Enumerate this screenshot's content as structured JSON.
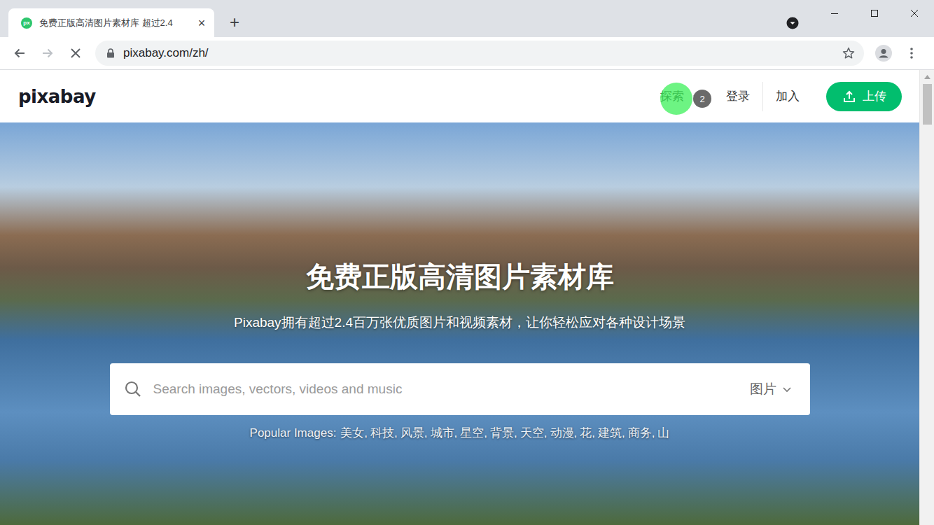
{
  "tabs": [
    {
      "title": "免费正版高清图片素材库 超过2.4",
      "favicon": "px",
      "close": "×",
      "selected": true
    }
  ],
  "new_tab": "+",
  "toolbar": {
    "url": "pixabay.com/zh/",
    "loading": true,
    "back_disabled": false,
    "forward_disabled": true
  },
  "page": {
    "logo": "pixabay",
    "nav": [
      {
        "label": "探索",
        "kind": "dropdown"
      },
      {
        "label": "登录",
        "kind": "link"
      },
      {
        "label": "加入",
        "kind": "link"
      },
      {
        "label": "上传",
        "kind": "button"
      }
    ],
    "cursor": {
      "badge": "2"
    }
  },
  "hero": {
    "title": "免费正版高清图片素材库",
    "subtitle": "Pixabay拥有超过2.4百万张优质图片和视频素材，让你轻松应对各种设计场景",
    "search": {
      "placeholder": "Search images, vectors, videos and music",
      "type": "图片"
    },
    "popular": {
      "label": "Popular Images:",
      "items": [
        "美女,",
        "科技,",
        "风景,",
        "城市,",
        "星空,",
        "背景,",
        "天空,",
        "动漫,",
        "花,",
        "建筑,",
        "商务,",
        "山"
      ]
    }
  }
}
